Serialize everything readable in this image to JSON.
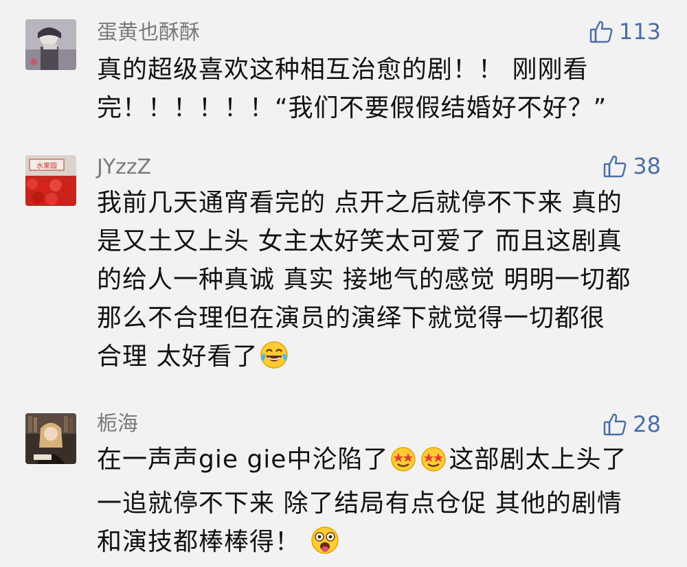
{
  "comments": [
    {
      "username": "蛋黄也酥酥",
      "likes": "113",
      "lines": [
        "真的超级喜欢这种相互治愈的剧！！ 刚刚看",
        "完！！！！！！“我们不要假假结婚好不好？”"
      ]
    },
    {
      "username": "JYzzZ",
      "likes": "38",
      "lines": [
        "我前几天通宵看完的 点开之后就停不下来 真的",
        "是又土又上头 女主太好笑太可爱了 而且这剧真",
        "的给人一种真诚 真实 接地气的感觉 明明一切都",
        "那么不合理但在演员的演绎下就觉得一切都很",
        "合理 太好看了"
      ]
    },
    {
      "username": "栀海",
      "likes": "28",
      "lines": [
        "在一声声gie gie中沦陷了",
        "这部剧太上头了",
        "一追就停不下来 除了结局有点仓促 其他的剧情",
        "和演技都棒棒得！"
      ]
    }
  ],
  "icons": {
    "like": "thumbs-up-icon",
    "emoji_laugh": "tears-of-joy-emoji",
    "emoji_star_eyes": "star-eyes-emoji",
    "emoji_surprised": "surprised-tongue-emoji"
  },
  "colors": {
    "background": "#f2f2f2",
    "username": "#7a7a7a",
    "like": "#4a6ea5",
    "text": "#111111"
  }
}
